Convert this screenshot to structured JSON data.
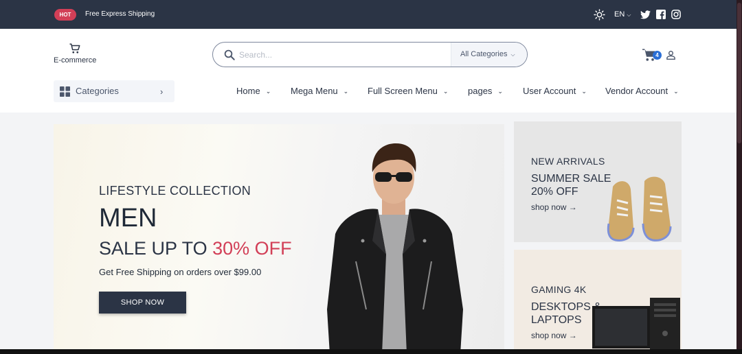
{
  "topbar": {
    "badge": "HOT",
    "promo": "Free Express Shipping",
    "language": "EN",
    "icons": [
      "sun-icon",
      "twitter-icon",
      "facebook-icon",
      "instagram-icon"
    ]
  },
  "header": {
    "logo_text": "E-commerce",
    "search": {
      "placeholder": "Search...",
      "category": "All Categories"
    },
    "cart_count": "4"
  },
  "nav": {
    "categories_label": "Categories",
    "items": [
      "Home",
      "Mega Menu",
      "Full Screen Menu",
      "pages",
      "User Account",
      "Vendor Account"
    ]
  },
  "hero": {
    "subtitle": "LIFESTYLE COLLECTION",
    "title": "MEN",
    "sale_prefix": "SALE UP TO ",
    "sale_accent": "30% OFF",
    "shipping": "Get Free Shipping on orders over $99.00",
    "button": "SHOP NOW"
  },
  "banners": [
    {
      "eyebrow": "NEW ARRIVALS",
      "title": "SUMMER SALE 20% OFF",
      "link": "shop now →"
    },
    {
      "eyebrow": "GAMING 4K",
      "title": "DESKTOPS & LAPTOPS",
      "link": "shop now →"
    }
  ],
  "colors": {
    "primary": "#2b3445",
    "accent": "#d23f57",
    "badge_blue": "#2b6fd6"
  }
}
